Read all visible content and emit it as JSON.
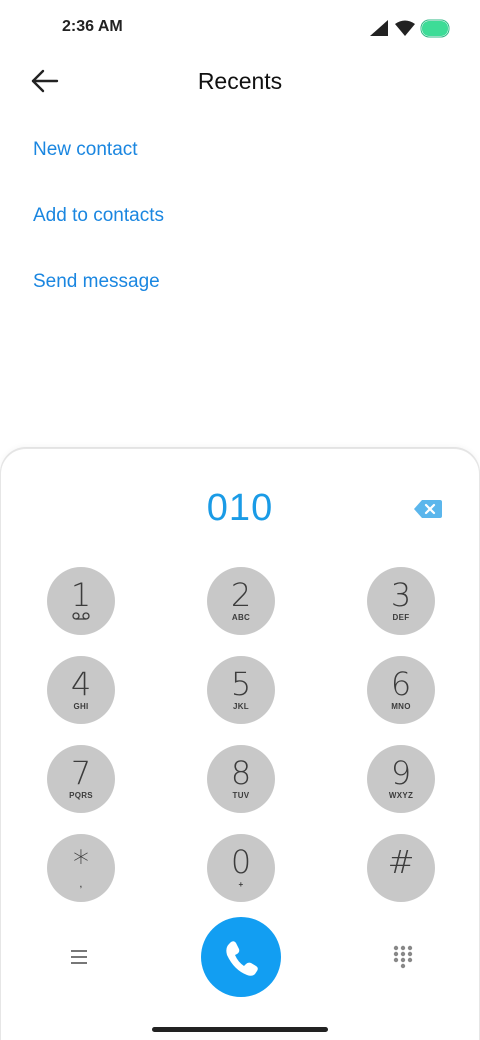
{
  "status_bar": {
    "time": "2:36 AM",
    "icons": [
      "signal-icon",
      "wifi-icon",
      "battery-icon"
    ],
    "battery_color": "#3ddc97"
  },
  "header": {
    "title": "Recents",
    "back_icon": "back-arrow-icon"
  },
  "actions": [
    {
      "label": "New contact"
    },
    {
      "label": "Add to contacts"
    },
    {
      "label": "Send message"
    }
  ],
  "dialer": {
    "number": "010",
    "backspace_icon": "backspace-icon",
    "keys": [
      {
        "digit": "1",
        "letters": "",
        "sub_icon": "voicemail-icon"
      },
      {
        "digit": "2",
        "letters": "ABC"
      },
      {
        "digit": "3",
        "letters": "DEF"
      },
      {
        "digit": "4",
        "letters": "GHI"
      },
      {
        "digit": "5",
        "letters": "JKL"
      },
      {
        "digit": "6",
        "letters": "MNO"
      },
      {
        "digit": "7",
        "letters": "PQRS"
      },
      {
        "digit": "8",
        "letters": "TUV"
      },
      {
        "digit": "9",
        "letters": "WXYZ"
      },
      {
        "digit": "*",
        "letters": ","
      },
      {
        "digit": "0",
        "letters": "+"
      },
      {
        "digit": "#",
        "letters": ""
      }
    ],
    "bottom": {
      "menu_icon": "menu-icon",
      "call_icon": "phone-icon",
      "dialpad_icon": "dialpad-icon"
    }
  },
  "colors": {
    "accent": "#1a86e0",
    "number": "#1a9be6",
    "call_button": "#129ef2",
    "key_background": "#c8c8c8"
  }
}
